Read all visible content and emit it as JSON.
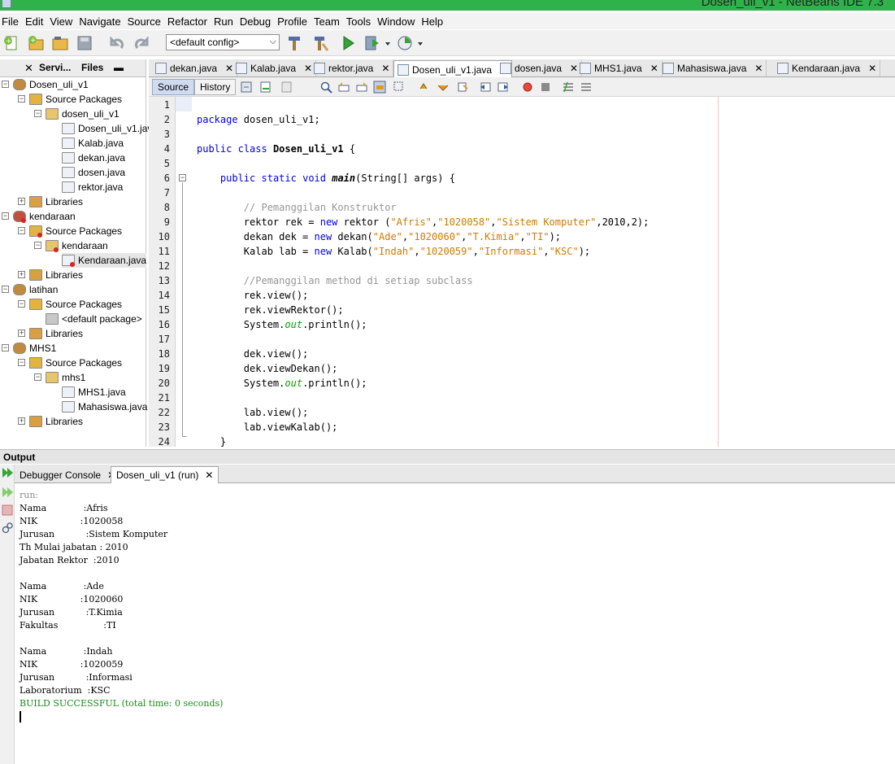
{
  "window": {
    "title": "Dosen_uli_v1 - NetBeans IDE 7.3"
  },
  "menu": [
    "File",
    "Edit",
    "View",
    "Navigate",
    "Source",
    "Refactor",
    "Run",
    "Debug",
    "Profile",
    "Team",
    "Tools",
    "Window",
    "Help"
  ],
  "toolbar": {
    "config_value": "<default config>"
  },
  "left_panel": {
    "tabs": [
      "Servi...",
      "Files"
    ],
    "tree": [
      {
        "label": "Dosen_uli_v1",
        "icon": "project-icon",
        "level": 0
      },
      {
        "label": "Source Packages",
        "icon": "source-packages-icon",
        "level": 1
      },
      {
        "label": "dosen_uli_v1",
        "icon": "package-icon",
        "level": 2
      },
      {
        "label": "Dosen_uli_v1.jav",
        "icon": "java-main-file-icon",
        "level": 3
      },
      {
        "label": "Kalab.java",
        "icon": "java-file-icon",
        "level": 3
      },
      {
        "label": "dekan.java",
        "icon": "java-file-icon",
        "level": 3
      },
      {
        "label": "dosen.java",
        "icon": "java-file-icon",
        "level": 3
      },
      {
        "label": "rektor.java",
        "icon": "java-file-icon",
        "level": 3
      },
      {
        "label": "Libraries",
        "icon": "libraries-icon",
        "level": 1
      },
      {
        "label": "kendaraan",
        "icon": "project-error-icon",
        "level": 0
      },
      {
        "label": "Source Packages",
        "icon": "source-packages-error-icon",
        "level": 1
      },
      {
        "label": "kendaraan",
        "icon": "package-error-icon",
        "level": 2
      },
      {
        "label": "Kendaraan.java",
        "icon": "java-error-file-icon",
        "level": 3
      },
      {
        "label": "Libraries",
        "icon": "libraries-icon",
        "level": 1
      },
      {
        "label": "latihan",
        "icon": "project-icon",
        "level": 0
      },
      {
        "label": "Source Packages",
        "icon": "source-packages-icon",
        "level": 1
      },
      {
        "label": "<default package>",
        "icon": "package-empty-icon",
        "level": 2
      },
      {
        "label": "Libraries",
        "icon": "libraries-icon",
        "level": 1
      },
      {
        "label": "MHS1",
        "icon": "project-icon",
        "level": 0
      },
      {
        "label": "Source Packages",
        "icon": "source-packages-icon",
        "level": 1
      },
      {
        "label": "mhs1",
        "icon": "package-icon",
        "level": 2
      },
      {
        "label": "MHS1.java",
        "icon": "java-file-icon",
        "level": 3
      },
      {
        "label": "Mahasiswa.java",
        "icon": "java-file-icon",
        "level": 3
      },
      {
        "label": "Libraries",
        "icon": "libraries-icon",
        "level": 1
      }
    ]
  },
  "editor_tabs": [
    {
      "label": "dekan.java",
      "active": false
    },
    {
      "label": "Kalab.java",
      "active": false
    },
    {
      "label": "rektor.java",
      "active": false
    },
    {
      "label": "Dosen_uli_v1.java",
      "active": true
    },
    {
      "label": "dosen.java",
      "active": false
    },
    {
      "label": "MHS1.java",
      "active": false
    },
    {
      "label": "Mahasiswa.java",
      "active": false
    },
    {
      "label": "Kendaraan.java",
      "active": false
    }
  ],
  "editor_bar": {
    "source_label": "Source",
    "history_label": "History"
  },
  "code_lines": [
    "",
    "package dosen_uli_v1;",
    "",
    "public class Dosen_uli_v1 {",
    "",
    "    public static void main(String[] args) {",
    "",
    "        // Pemanggilan Konstruktor",
    "        rektor rek = new rektor (\"Afris\",\"1020058\",\"Sistem Komputer\",2010,2);",
    "        dekan dek = new dekan(\"Ade\",\"1020060\",\"T.Kimia\",\"TI\");",
    "        Kalab lab = new Kalab(\"Indah\",\"1020059\",\"Informasi\",\"KSC\");",
    "",
    "        //Pemanggilan method di setiap subclass",
    "        rek.view();",
    "        rek.viewRektor();",
    "        System.out.println();",
    "",
    "        dek.view();",
    "        dek.viewDekan();",
    "        System.out.println();",
    "",
    "        lab.view();",
    "        lab.viewKalab();",
    "    }"
  ],
  "output": {
    "header": "Output",
    "tabs": [
      {
        "label": "Debugger Console",
        "active": false
      },
      {
        "label": "Dosen_uli_v1 (run)",
        "active": true
      }
    ],
    "lines": [
      "run:",
      "Nama             :Afris",
      "NIK               :1020058",
      "Jurusan           :Sistem Komputer",
      "Th Mulai jabatan : 2010",
      "Jabatan Rektor  :2010",
      "",
      "Nama             :Ade",
      "NIK               :1020060",
      "Jurusan           :T.Kimia",
      "Fakultas                :TI",
      "",
      "Nama             :Indah",
      "NIK               :1020059",
      "Jurusan           :Informasi",
      "Laboratorium  :KSC",
      "BUILD SUCCESSFUL (total time: 0 seconds)"
    ]
  }
}
